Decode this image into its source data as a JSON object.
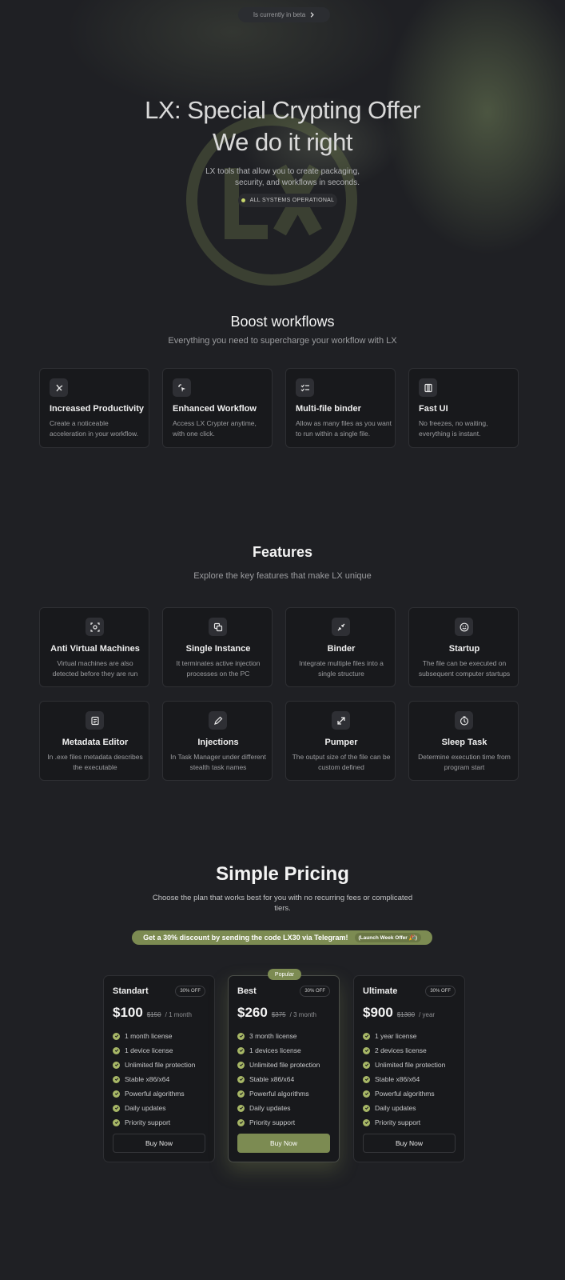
{
  "hero": {
    "beta_label": "Is currently in beta",
    "title_line1": "LX: Special Crypting Offer",
    "title_line2": "We do it right",
    "subtitle_line1": "LX tools that allow you to create packaging,",
    "subtitle_line2": "security, and workflows in seconds.",
    "status": "ALL SYSTEMS OPERATIONAL",
    "logo_text": "LX"
  },
  "workflows": {
    "title": "Boost workflows",
    "subtitle": "Everything you need to supercharge your workflow with LX",
    "cards": [
      {
        "icon": "branch-icon",
        "title": "Increased Productivity",
        "desc": "Create a noticeable acceleration in your workflow."
      },
      {
        "icon": "sparkle-cursor-icon",
        "title": "Enhanced Workflow",
        "desc": "Access LX Crypter anytime, with one click."
      },
      {
        "icon": "checklist-icon",
        "title": "Multi-file binder",
        "desc": "Allow as many files as you want to run within a single file."
      },
      {
        "icon": "columns-icon",
        "title": "Fast UI",
        "desc": "No freezes, no waiting, everything is instant."
      }
    ]
  },
  "features": {
    "title": "Features",
    "subtitle": "Explore the key features that make LX unique",
    "cards": [
      {
        "icon": "scan-icon",
        "title": "Anti Virtual Machines",
        "desc": "Virtual machines are also detected before they are run"
      },
      {
        "icon": "copy-icon",
        "title": "Single Instance",
        "desc": "It terminates active injection processes on the PC"
      },
      {
        "icon": "merge-arrows-icon",
        "title": "Binder",
        "desc": "Integrate multiple files into a single structure"
      },
      {
        "icon": "smile-icon",
        "title": "Startup",
        "desc": "The file can be executed on subsequent computer startups"
      },
      {
        "icon": "document-icon",
        "title": "Metadata Editor",
        "desc": "In .exe files metadata describes the executable"
      },
      {
        "icon": "pencil-icon",
        "title": "Injections",
        "desc": "In Task Manager under different stealth task names"
      },
      {
        "icon": "expand-arrows-icon",
        "title": "Pumper",
        "desc": "The output size of the file can be custom defined"
      },
      {
        "icon": "timer-icon",
        "title": "Sleep Task",
        "desc": "Determine execution time from program start"
      }
    ]
  },
  "pricing": {
    "title": "Simple Pricing",
    "subtitle_line1": "Choose the plan that works best for you with no recurring fees or complicated",
    "subtitle_line2": "tiers.",
    "promo": "Get a 30% discount by sending the code LX30 via Telegram!",
    "promo_tag": "(Launch Week Offer 🎉)",
    "popular_label": "Popular",
    "plans": [
      {
        "name": "Standart",
        "discount": "30% OFF",
        "price": "$100",
        "old_price": "$150",
        "period": "/ 1 month",
        "features": [
          "1 month license",
          "1 device license",
          "Unlimited file protection",
          "Stable x86/x64",
          "Powerful algorithms",
          "Daily updates",
          "Priority support"
        ],
        "button": "Buy Now"
      },
      {
        "name": "Best",
        "discount": "30% OFF",
        "price": "$260",
        "old_price": "$375",
        "period": "/ 3 month",
        "features": [
          "3 month license",
          "1 devices license",
          "Unlimited file protection",
          "Stable x86/x64",
          "Powerful algorithms",
          "Daily updates",
          "Priority support"
        ],
        "button": "Buy Now"
      },
      {
        "name": "Ultimate",
        "discount": "30% OFF",
        "price": "$900",
        "old_price": "$1300",
        "period": "/ year",
        "features": [
          "1 year license",
          "2 devices license",
          "Unlimited file protection",
          "Stable x86/x64",
          "Powerful algorithms",
          "Daily updates",
          "Priority support"
        ],
        "button": "Buy Now"
      }
    ]
  },
  "colors": {
    "background": "#1f2024",
    "accent": "#7c8b52",
    "check": "#a7b766",
    "status_dot": "#c7d56a"
  }
}
